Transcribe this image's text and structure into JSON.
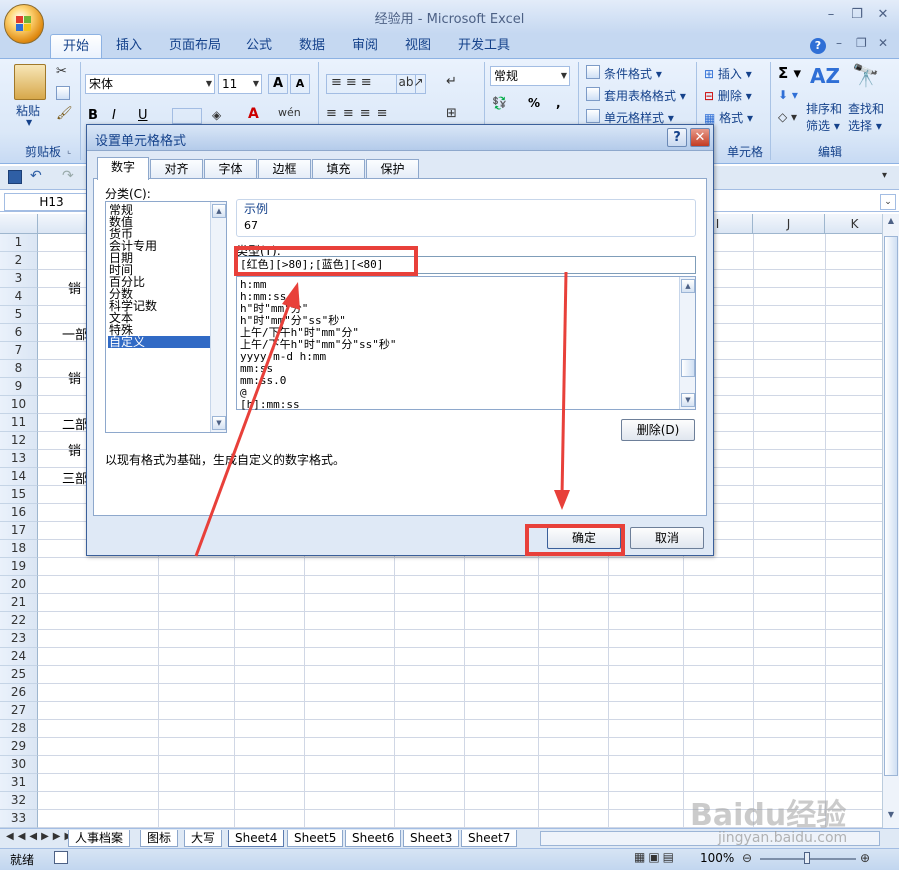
{
  "window": {
    "title": "经验用 - Microsoft Excel"
  },
  "ribbon_tabs": [
    "开始",
    "插入",
    "页面布局",
    "公式",
    "数据",
    "审阅",
    "视图",
    "开发工具"
  ],
  "ribbon": {
    "paste_label": "粘贴",
    "clipboard_group": "剪贴板",
    "font_name": "宋体",
    "font_size": "11",
    "number_format": "常规",
    "conditional_format": "条件格式",
    "table_format": "套用表格格式",
    "cell_style": "单元格样式",
    "insert": "插入",
    "delete": "删除",
    "format": "格式",
    "cells_group": "单元格",
    "sort_filter": "排序和\n筛选",
    "sort_filter_l1": "排序和",
    "sort_filter_l2": "筛选",
    "find_select_l1": "查找和",
    "find_select_l2": "选择",
    "edit_group": "编辑",
    "percent": "%",
    "comma": ","
  },
  "formula_bar": {
    "name_box": "H13"
  },
  "sheet": {
    "columns": [
      "I",
      "J",
      "K"
    ],
    "rows": [
      "1",
      "2",
      "3",
      "4",
      "5",
      "6",
      "7",
      "8",
      "9",
      "10",
      "11",
      "12",
      "13",
      "14",
      "15",
      "16",
      "17",
      "18",
      "19",
      "20",
      "21",
      "22",
      "23",
      "24",
      "25",
      "26",
      "27",
      "28",
      "29",
      "30",
      "31",
      "32",
      "33"
    ],
    "cells": [
      "销",
      "一部",
      "销",
      "二部",
      "销",
      "三部"
    ]
  },
  "sheet_tabs": [
    "人事档案",
    "图标",
    "大写",
    "Sheet4",
    "Sheet5",
    "Sheet6",
    "Sheet3",
    "Sheet7"
  ],
  "status": {
    "ready": "就绪",
    "zoom": "100%"
  },
  "dialog": {
    "title": "设置单元格格式",
    "help": "?",
    "close": "✕",
    "tabs": [
      "数字",
      "对齐",
      "字体",
      "边框",
      "填充",
      "保护"
    ],
    "category_label": "分类(C):",
    "categories": [
      "常规",
      "数值",
      "货币",
      "会计专用",
      "日期",
      "时间",
      "百分比",
      "分数",
      "科学记数",
      "文本",
      "特殊",
      "自定义"
    ],
    "sample_label": "示例",
    "sample_value": "67",
    "type_label": "类型(T):",
    "type_value": "[红色][>80];[蓝色][<80]",
    "formats": [
      "h:mm",
      "h:mm:ss",
      "h\"时\"mm\"分\"",
      "h\"时\"mm\"分\"ss\"秒\"",
      "上午/下午h\"时\"mm\"分\"",
      "上午/下午h\"时\"mm\"分\"ss\"秒\"",
      "yyyy-m-d h:mm",
      "mm:ss",
      "mm:ss.0",
      "@",
      "[h]:mm:ss"
    ],
    "delete_button": "删除(D)",
    "description": "以现有格式为基础，生成自定义的数字格式。",
    "ok_button": "确定",
    "cancel_button": "取消"
  },
  "watermark": {
    "text": "Baidu经验",
    "url": "jingyan.baidu.com"
  },
  "colors": {
    "highlight": "#e8403a",
    "selection": "#316ac5",
    "ribbon": "#dbe8f8"
  }
}
